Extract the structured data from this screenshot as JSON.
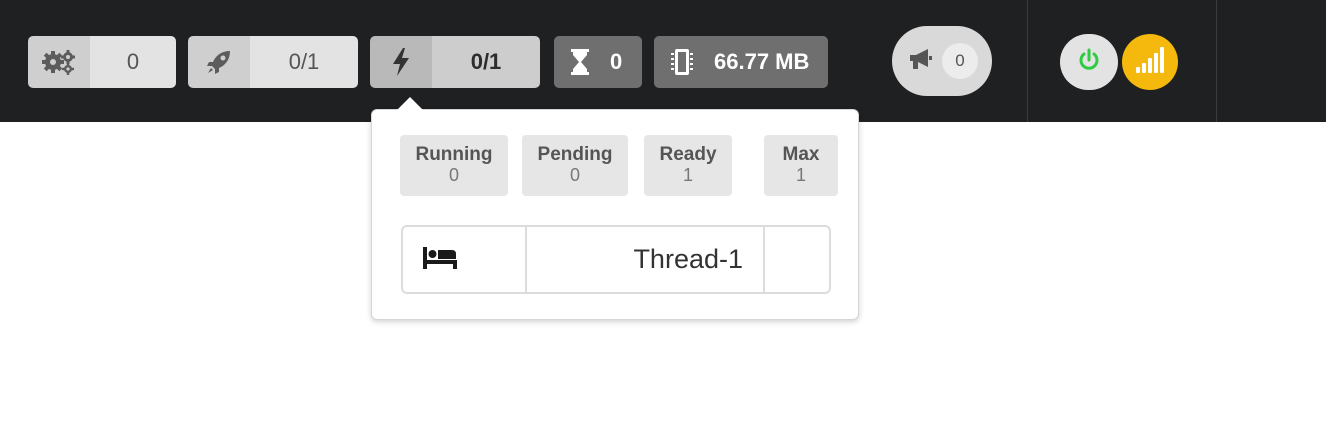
{
  "toolbar": {
    "workers": {
      "icon": "gears-icon",
      "value": "0"
    },
    "launched": {
      "icon": "rocket-icon",
      "value": "0/1"
    },
    "threads": {
      "icon": "bolt-icon",
      "value": "0/1"
    },
    "waiting": {
      "icon": "hourglass-icon",
      "value": "0"
    },
    "memory": {
      "icon": "memory-chip-icon",
      "value": "66.77 MB"
    },
    "announcements": {
      "icon": "megaphone-icon",
      "count": "0"
    },
    "power": {
      "icon": "power-icon",
      "color": "#2ecc40"
    },
    "signal": {
      "icon": "signal-bars-icon",
      "color": "#f5b80c"
    }
  },
  "popover": {
    "stats": [
      {
        "label": "Running",
        "value": "0"
      },
      {
        "label": "Pending",
        "value": "0"
      },
      {
        "label": "Ready",
        "value": "1"
      },
      {
        "label": "Max",
        "value": "1"
      }
    ],
    "threads": [
      {
        "icon": "bed-icon",
        "name": "Thread-1",
        "extra": ""
      }
    ]
  },
  "colors": {
    "topbar": "#1f2022",
    "accent": "#f5b80c",
    "power_green": "#2ecc40"
  }
}
